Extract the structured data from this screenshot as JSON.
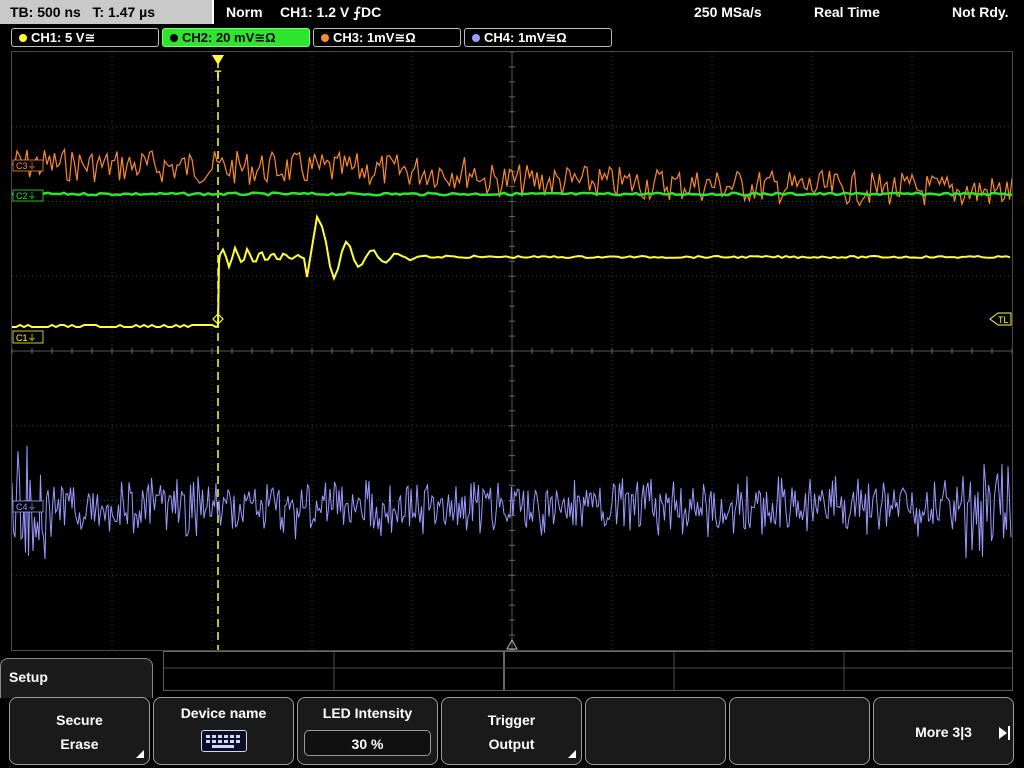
{
  "status": {
    "timebase": "TB: 500 ns",
    "trigger_time": "T: 1.47 µs",
    "mode": "Norm",
    "trigger_source": "CH1: 1.2 V ⨍DC",
    "sample_rate": "250 MSa/s",
    "acq_mode": "Real Time",
    "state": "Not Rdy."
  },
  "channels": [
    {
      "label": "CH1: 5 V≅",
      "color": "#ffff33"
    },
    {
      "label": "CH2: 20 mV≅Ω",
      "color": "#2ee52e"
    },
    {
      "label": "CH3: 1mV≅Ω",
      "color": "#ff8a2a"
    },
    {
      "label": "CH4: 1mV≅Ω",
      "color": "#9a9aff"
    }
  ],
  "markers": {
    "c1": "C1⏚",
    "c2": "C2⏚",
    "c3": "C3⏚",
    "c4": "C4⏚",
    "trigger_level": "TL",
    "trigger_pos": "T"
  },
  "menu": {
    "title": "Setup",
    "softkeys": [
      {
        "line1": "Secure",
        "line2": "Erase"
      },
      {
        "line1": "Device name",
        "icon": "keyboard-icon"
      },
      {
        "line1": "LED Intensity",
        "value": "30 %"
      },
      {
        "line1": "Trigger",
        "line2": "Output"
      },
      {
        "line1": ""
      },
      {
        "line1": ""
      },
      {
        "line1": "More 3|3"
      }
    ]
  },
  "colors": {
    "ch1": "#ffff33",
    "ch2": "#2ee52e",
    "ch3": "#ff8a2a",
    "ch4": "#9a9aff",
    "grid": "#3c3c3c"
  }
}
